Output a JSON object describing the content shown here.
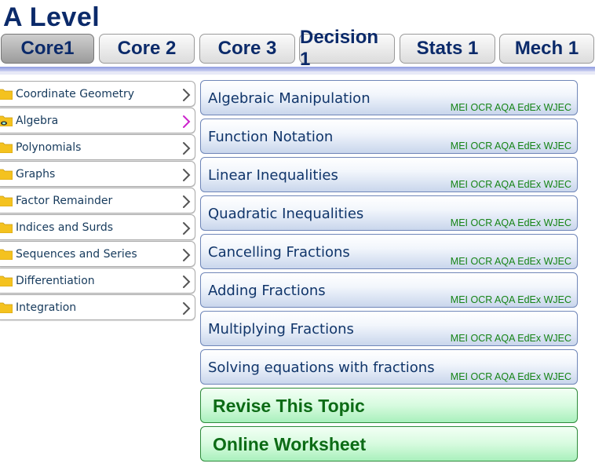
{
  "page_title": "A Level",
  "tabs": [
    {
      "label": "Core1",
      "active": true
    },
    {
      "label": "Core 2",
      "active": false
    },
    {
      "label": "Core 3",
      "active": false
    },
    {
      "label": "Decision 1",
      "active": false
    },
    {
      "label": "Stats 1",
      "active": false
    },
    {
      "label": "Mech 1",
      "active": false
    }
  ],
  "topics": [
    {
      "label": "Coordinate Geometry",
      "selected": false
    },
    {
      "label": "Algebra",
      "selected": true
    },
    {
      "label": "Polynomials",
      "selected": false
    },
    {
      "label": "Graphs",
      "selected": false
    },
    {
      "label": "Factor Remainder",
      "selected": false
    },
    {
      "label": "Indices and Surds",
      "selected": false
    },
    {
      "label": "Sequences and Series",
      "selected": false
    },
    {
      "label": "Differentiation",
      "selected": false
    },
    {
      "label": "Integration",
      "selected": false
    }
  ],
  "subtopics": [
    {
      "label": "Algebraic Manipulation",
      "boards": "MEI OCR AQA EdEx WJEC"
    },
    {
      "label": "Function Notation",
      "boards": "MEI OCR AQA EdEx WJEC"
    },
    {
      "label": "Linear Inequalities",
      "boards": "MEI OCR AQA EdEx WJEC"
    },
    {
      "label": "Quadratic Inequalities",
      "boards": "MEI OCR AQA EdEx WJEC"
    },
    {
      "label": "Cancelling Fractions",
      "boards": "MEI OCR AQA EdEx WJEC"
    },
    {
      "label": "Adding Fractions",
      "boards": "MEI OCR AQA EdEx WJEC"
    },
    {
      "label": "Multiplying Fractions",
      "boards": "MEI OCR AQA EdEx WJEC"
    },
    {
      "label": "Solving equations with fractions",
      "boards": "MEI OCR AQA EdEx WJEC"
    }
  ],
  "actions": {
    "revise_label": "Revise This Topic",
    "worksheet_label": "Online Worksheet"
  },
  "colors": {
    "title": "#0b2a6a",
    "board_text": "#168416",
    "chevron_default": "#555555",
    "chevron_selected": "#cc22cc",
    "folder": "#f4c21f",
    "action_text": "#0c6b15"
  },
  "icons": {
    "topic_item": "folder-icon",
    "topic_selected": "folder-open-icon",
    "topic_arrow": "chevron-right-icon"
  }
}
